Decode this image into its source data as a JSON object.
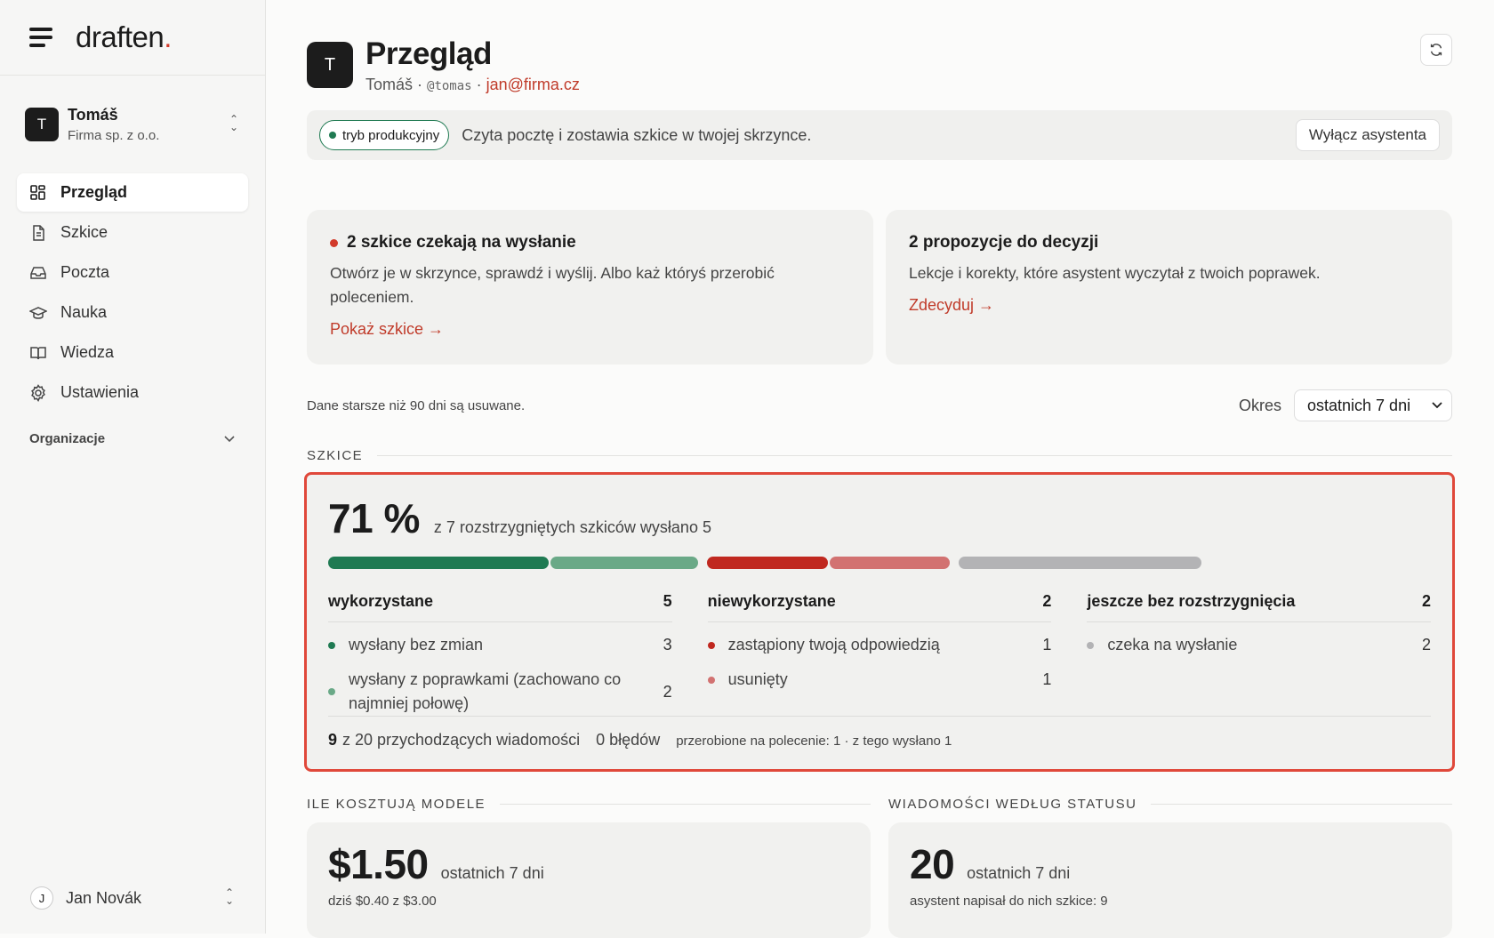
{
  "brand": {
    "name": "draften",
    "dot": "."
  },
  "account": {
    "initial": "T",
    "name": "Tomáš",
    "company": "Firma sp. z o.o."
  },
  "nav": [
    {
      "label": "Przegląd",
      "icon": "grid-icon",
      "active": true
    },
    {
      "label": "Szkice",
      "icon": "document-icon",
      "active": false
    },
    {
      "label": "Poczta",
      "icon": "inbox-icon",
      "active": false
    },
    {
      "label": "Nauka",
      "icon": "graduation-cap-icon",
      "active": false
    },
    {
      "label": "Wiedza",
      "icon": "book-icon",
      "active": false
    },
    {
      "label": "Ustawienia",
      "icon": "gear-icon",
      "active": false
    }
  ],
  "org_label": "Organizacje",
  "user": {
    "initial": "J",
    "name": "Jan Novák"
  },
  "header": {
    "initial": "T",
    "title": "Przegląd",
    "name": "Tomáš",
    "handle": "@tomas",
    "email": "jan@firma.cz"
  },
  "mode": {
    "badge": "tryb produkcyjny",
    "desc": "Czyta pocztę i zostawia szkice w twojej skrzynce.",
    "button": "Wyłącz asystenta"
  },
  "cards": [
    {
      "title": "2 szkice czekają na wysłanie",
      "desc": "Otwórz je w skrzynce, sprawdź i wyślij. Albo każ któryś przerobić poleceniem.",
      "link": "Pokaż szkice →"
    },
    {
      "title": "2 propozycje do decyzji",
      "desc": "Lekcje i korekty, które asystent wyczytał z twoich poprawek.",
      "link": "Zdecyduj →"
    }
  ],
  "retention_note": "Dane starsze niż 90 dni są usuwane.",
  "period": {
    "label": "Okres",
    "value": "ostatnich 7 dni"
  },
  "drafts": {
    "section": "SZKICE",
    "percent": "71 %",
    "summary": "z 7 rozstrzygniętych szkiców wysłano 5",
    "columns": [
      {
        "title": "wykorzystane",
        "total": "5",
        "rows": [
          {
            "label": "wysłany bez zmian",
            "value": "3",
            "color": "#1f7a52"
          },
          {
            "label": "wysłany z poprawkami (zachowano co najmniej połowę)",
            "value": "2",
            "color": "#6aa987"
          }
        ]
      },
      {
        "title": "niewykorzystane",
        "total": "2",
        "rows": [
          {
            "label": "zastąpiony twoją odpowiedzią",
            "value": "1",
            "color": "#c0281f"
          },
          {
            "label": "usunięty",
            "value": "1",
            "color": "#d27271"
          }
        ]
      },
      {
        "title": "jeszcze bez rozstrzygnięcia",
        "total": "2",
        "rows": [
          {
            "label": "czeka na wysłanie",
            "value": "2",
            "color": "#b3b3b5"
          }
        ]
      }
    ],
    "footer": {
      "count": "9",
      "count_text": "z 20 przychodzących wiadomości",
      "errors": "0 błędów",
      "reworked": "przerobione na polecenie: 1 · z tego wysłano 1"
    }
  },
  "costs": {
    "section": "ILE KOSZTUJĄ MODELE",
    "amount": "$1.50",
    "period": "ostatnich 7 dni",
    "today": "dziś $0.40 z $3.00"
  },
  "messages": {
    "section": "WIADOMOŚCI WEDŁUG STATUSU",
    "count": "20",
    "period": "ostatnich 7 dni",
    "note": "asystent napisał do nich szkice: 9"
  }
}
